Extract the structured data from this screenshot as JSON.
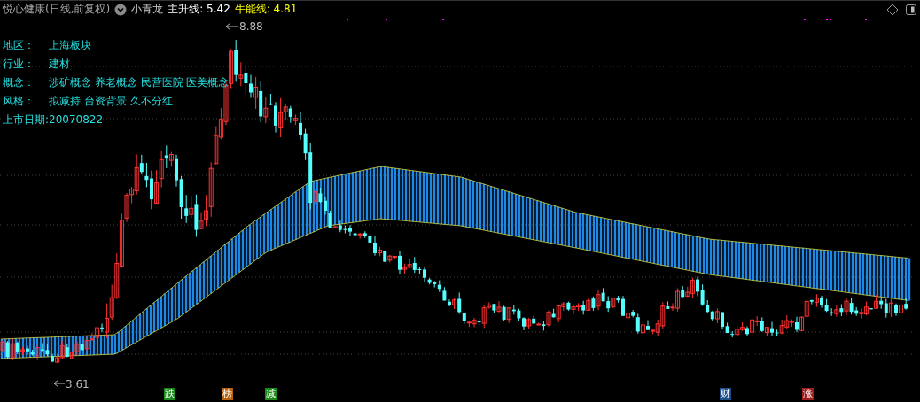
{
  "header": {
    "stock": "悦心健康(日线,前复权)",
    "indicator": "小青龙",
    "lines": [
      {
        "label": "主升线: 5.42",
        "color": "#ffffff"
      },
      {
        "label": "牛能线: 4.81",
        "color": "#ffff00"
      }
    ]
  },
  "info": [
    {
      "label": "地区：",
      "value": "上海板块"
    },
    {
      "label": "行业：",
      "value": "建材"
    },
    {
      "label": "概念：",
      "value": "涉矿概念 养老概念 民营医院 医美概念"
    },
    {
      "label": "风格：",
      "value": "拟减持 台资背景 久不分红"
    }
  ],
  "listing_date": "上市日期:20070822",
  "chart": {
    "high_label": "8.88",
    "low_label": "3.61"
  },
  "markers": [
    {
      "label": "跌",
      "color": "#1a8a1a"
    },
    {
      "label": "榜",
      "color": "#b8600c"
    },
    {
      "label": "减",
      "color": "#1a8a1a"
    },
    {
      "label": "财",
      "color": "#1c4f8c"
    },
    {
      "label": "涨",
      "color": "#a01c1c"
    }
  ]
}
